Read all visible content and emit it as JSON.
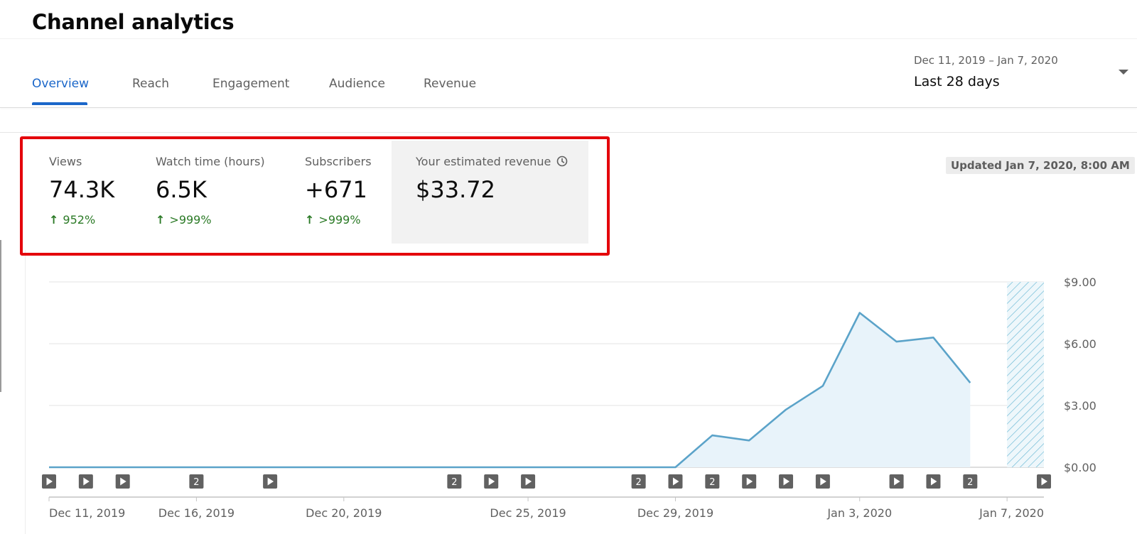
{
  "page": {
    "title": "Channel analytics"
  },
  "tabs": [
    {
      "label": "Overview",
      "active": true
    },
    {
      "label": "Reach"
    },
    {
      "label": "Engagement"
    },
    {
      "label": "Audience"
    },
    {
      "label": "Revenue"
    }
  ],
  "date_range": {
    "dates": "Dec 11, 2019 – Jan 7, 2020",
    "label": "Last 28 days"
  },
  "metrics": [
    {
      "label": "Views",
      "value": "74.3K",
      "change": "952%",
      "direction": "up"
    },
    {
      "label": "Watch time (hours)",
      "value": "6.5K",
      "change": ">999%",
      "direction": "up"
    },
    {
      "label": "Subscribers",
      "value": "+671",
      "change": ">999%",
      "direction": "up"
    },
    {
      "label": "Your estimated revenue",
      "value": "$33.72",
      "icon": "clock-icon"
    }
  ],
  "updated": "Updated Jan 7, 2020, 8:00 AM",
  "colors": {
    "accent": "#1a66c9",
    "positive": "#2b7a26",
    "highlight": "#e4040b",
    "line": "#5ba3c9",
    "area": "#e8f3fa"
  },
  "chart_data": {
    "type": "area",
    "y_ticks": [
      "$0.00",
      "$3.00",
      "$6.00",
      "$9.00"
    ],
    "ylim": [
      0,
      9
    ],
    "x_tick_labels": [
      {
        "day": 0,
        "label": "Dec 11, 2019"
      },
      {
        "day": 4,
        "label": "Dec 16, 2019"
      },
      {
        "day": 8,
        "label": "Dec 20, 2019"
      },
      {
        "day": 13,
        "label": "Dec 25, 2019"
      },
      {
        "day": 17,
        "label": "Dec 29, 2019"
      },
      {
        "day": 22,
        "label": "Jan 3, 2020"
      },
      {
        "day": 26,
        "label": "Jan 7, 2020"
      }
    ],
    "days": 27,
    "values": [
      0,
      0,
      0,
      0,
      0,
      0,
      0,
      0,
      0,
      0,
      0,
      0,
      0,
      0,
      0,
      0,
      0,
      0,
      1.55,
      1.3,
      2.8,
      3.95,
      7.5,
      6.1,
      6.3,
      4.1
    ],
    "partial_from_day": 26,
    "markers": [
      {
        "day": 0,
        "type": "video"
      },
      {
        "day": 1,
        "type": "video"
      },
      {
        "day": 2,
        "type": "video"
      },
      {
        "day": 4,
        "type": "count",
        "count": "2"
      },
      {
        "day": 6,
        "type": "video"
      },
      {
        "day": 11,
        "type": "count",
        "count": "2"
      },
      {
        "day": 12,
        "type": "video"
      },
      {
        "day": 13,
        "type": "video"
      },
      {
        "day": 16,
        "type": "count",
        "count": "2"
      },
      {
        "day": 17,
        "type": "video"
      },
      {
        "day": 18,
        "type": "count",
        "count": "2"
      },
      {
        "day": 19,
        "type": "video"
      },
      {
        "day": 20,
        "type": "video"
      },
      {
        "day": 21,
        "type": "video"
      },
      {
        "day": 23,
        "type": "video"
      },
      {
        "day": 24,
        "type": "video"
      },
      {
        "day": 25,
        "type": "count",
        "count": "2"
      },
      {
        "day": 27,
        "type": "video"
      }
    ]
  }
}
